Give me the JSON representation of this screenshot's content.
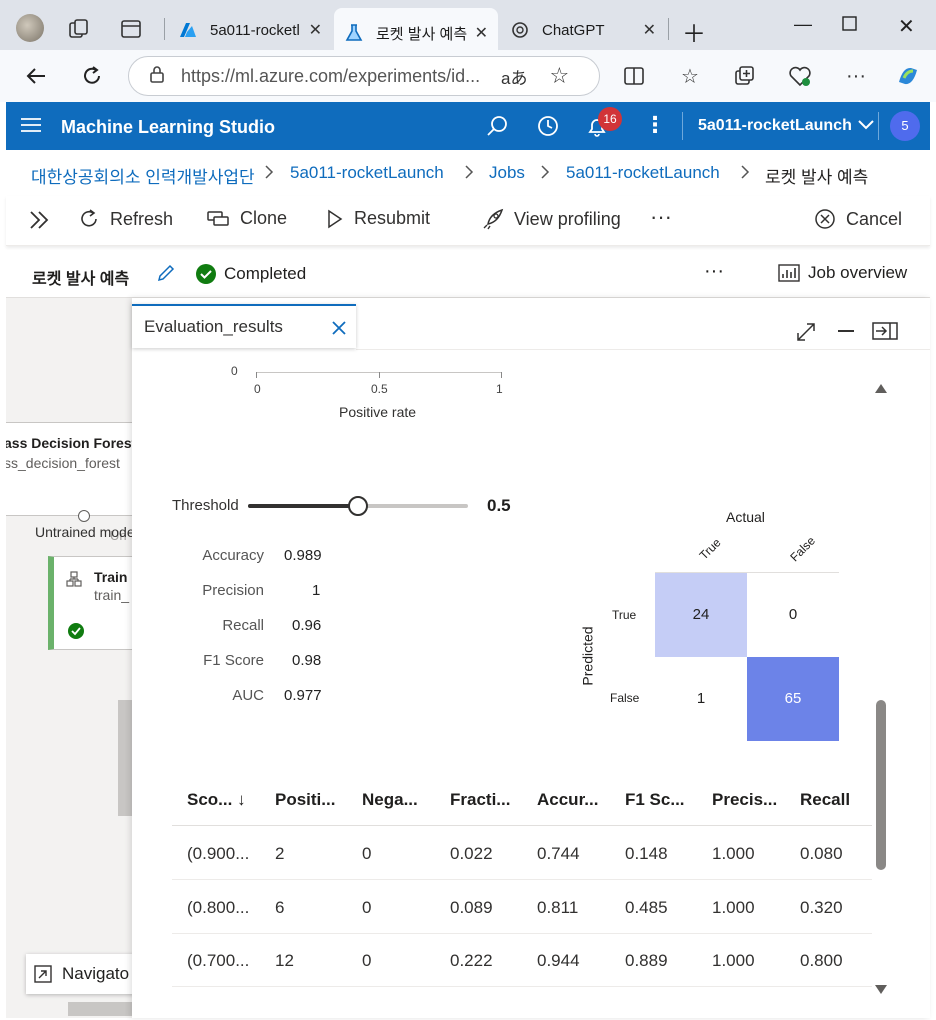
{
  "browser": {
    "tabs": [
      {
        "label": "5a011-rocketl",
        "icon": "azure-icon"
      },
      {
        "label": "로켓 발사 예측",
        "icon": "ml-flask-icon"
      },
      {
        "label": "ChatGPT",
        "icon": "chatgpt-icon"
      }
    ],
    "url": "https://ml.azure.com/experiments/id...",
    "url_read_aloud": "aあ"
  },
  "header": {
    "app_title": "Machine Learning Studio",
    "notification_count": "16",
    "workspace": "5a011-rocketLaunch",
    "avatar": "5",
    "brand_color": "#0f6cbd"
  },
  "breadcrumb": [
    "대한상공회의소 인력개발사업단",
    "5a011-rocketLaunch",
    "Jobs",
    "5a011-rocketLaunch",
    "로켓 발사 예측"
  ],
  "toolbar": {
    "refresh": "Refresh",
    "clone": "Clone",
    "resubmit": "Resubmit",
    "view_profiling": "View profiling",
    "cancel": "Cancel"
  },
  "job": {
    "title": "로켓 발사 예측",
    "status": "Completed",
    "overview": "Job overview"
  },
  "canvas": {
    "node1_title": "ass Decision Forest",
    "node1_sub": "ss_decision_forest",
    "port_label": "Untrained mode",
    "port_label_shadow": "Un",
    "node2_title": "Train",
    "node2_sub": "train_",
    "navigator": "Navigato"
  },
  "panel": {
    "tab_label": "Evaluation_results",
    "roc_axis": {
      "ticks": [
        "0",
        "0.5",
        "1"
      ],
      "y_tick": "0",
      "label": "Positive rate"
    },
    "threshold_label": "Threshold",
    "threshold_value": "0.5",
    "metrics": [
      {
        "name": "Accuracy",
        "value": "0.989"
      },
      {
        "name": "Precision",
        "value": "1"
      },
      {
        "name": "Recall",
        "value": "0.96"
      },
      {
        "name": "F1 Score",
        "value": "0.98"
      },
      {
        "name": "AUC",
        "value": "0.977"
      }
    ],
    "confusion": {
      "actual_label": "Actual",
      "predicted_label": "Predicted",
      "col_labels": [
        "True",
        "False"
      ],
      "row_labels": [
        "True",
        "False"
      ],
      "cells": [
        [
          "24",
          "0"
        ],
        [
          "1",
          "65"
        ]
      ]
    },
    "grid": {
      "columns": [
        "Sco... ↓",
        "Positi...",
        "Nega...",
        "Fracti...",
        "Accur...",
        "F1 Sc...",
        "Precis...",
        "Recall"
      ],
      "rows": [
        [
          "(0.900...",
          "2",
          "0",
          "0.022",
          "0.744",
          "0.148",
          "1.000",
          "0.080"
        ],
        [
          "(0.800...",
          "6",
          "0",
          "0.089",
          "0.811",
          "0.485",
          "1.000",
          "0.320"
        ],
        [
          "(0.700...",
          "12",
          "0",
          "0.222",
          "0.944",
          "0.889",
          "1.000",
          "0.800"
        ]
      ]
    }
  }
}
